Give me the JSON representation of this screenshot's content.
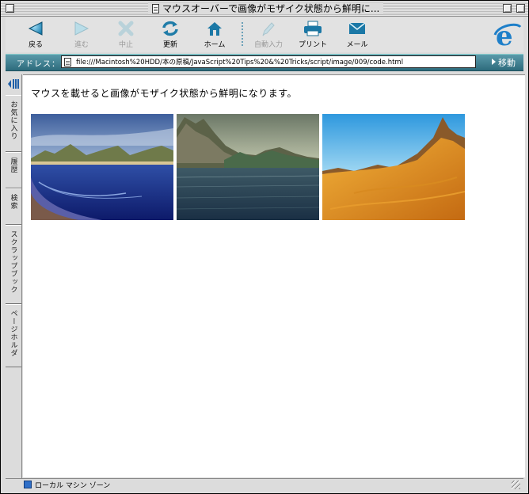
{
  "window": {
    "title": "マウスオーバーで画像がモザイク状態から鮮明に..."
  },
  "toolbar": {
    "back": "戻る",
    "forward": "進む",
    "stop": "中止",
    "refresh": "更新",
    "home": "ホーム",
    "autofill": "自動入力",
    "print": "プリント",
    "mail": "メール"
  },
  "address": {
    "label": "アドレス：",
    "url": "file:///Macintosh%20HDD/本の原稿/JavaScript%20Tips%20&%20Tricks/script/image/009/code.html",
    "go": "移動"
  },
  "sidebar": {
    "tabs": [
      "お気に入り",
      "履歴",
      "検索",
      "スクラップブック",
      "ページホルダ"
    ]
  },
  "page": {
    "text": "マウスを載せると画像がモザイク状態から鮮明になります。",
    "images": [
      {
        "name": "coast-landscape-image"
      },
      {
        "name": "mountain-lake-image"
      },
      {
        "name": "desert-peak-image"
      }
    ]
  },
  "status": {
    "zone": "ローカル マシン ゾーン"
  },
  "colors": {
    "accent": "#2d6b7c",
    "ie_blue": "#1e7fc9"
  }
}
